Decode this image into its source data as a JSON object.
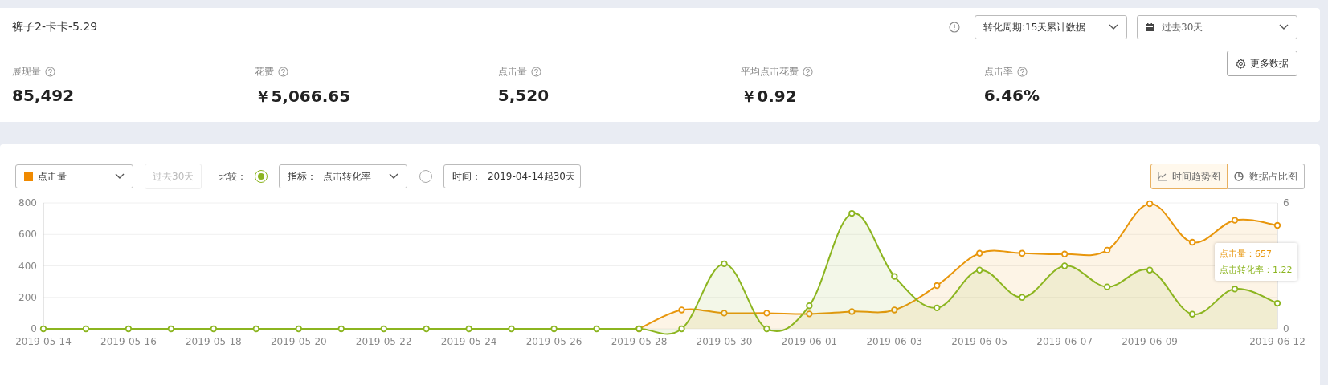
{
  "header": {
    "title": "裤子2-卡卡-5.29",
    "conversion_period": "转化周期:15天累计数据",
    "date_range": "过去30天",
    "more_button": "更多数据"
  },
  "metrics": [
    {
      "label": "展现量",
      "value": "85,492"
    },
    {
      "label": "花费",
      "value": "￥5,066.65"
    },
    {
      "label": "点击量",
      "value": "5,520"
    },
    {
      "label": "平均点击花费",
      "value": "￥0.92"
    },
    {
      "label": "点击率",
      "value": "6.46%"
    }
  ],
  "controls": {
    "metric": {
      "label": "点击量",
      "color": "#f08a00"
    },
    "period": "过去30天",
    "compare_label": "比较：",
    "compare_options": [
      {
        "kind": "metric",
        "label": "指标：",
        "value": "点击转化率",
        "selected": true
      },
      {
        "kind": "time",
        "label": "时间：",
        "value": "2019-04-14起30天",
        "selected": false
      }
    ]
  },
  "view_tabs": [
    {
      "kind": "line",
      "label": "时间趋势图",
      "selected": true
    },
    {
      "kind": "pie",
      "label": "数据占比图",
      "selected": false
    }
  ],
  "chart": {
    "chart_data": {
      "type": "line",
      "x": [
        "2019-05-14",
        "2019-05-15",
        "2019-05-16",
        "2019-05-17",
        "2019-05-18",
        "2019-05-19",
        "2019-05-20",
        "2019-05-21",
        "2019-05-22",
        "2019-05-23",
        "2019-05-24",
        "2019-05-25",
        "2019-05-26",
        "2019-05-27",
        "2019-05-28",
        "2019-05-29",
        "2019-05-30",
        "2019-05-31",
        "2019-06-01",
        "2019-06-02",
        "2019-06-03",
        "2019-06-04",
        "2019-06-05",
        "2019-06-06",
        "2019-06-07",
        "2019-06-08",
        "2019-06-09",
        "2019-06-10",
        "2019-06-11",
        "2019-06-12"
      ],
      "xticks": [
        "2019-05-14",
        "2019-05-16",
        "2019-05-18",
        "2019-05-20",
        "2019-05-22",
        "2019-05-24",
        "2019-05-26",
        "2019-05-28",
        "2019-05-30",
        "2019-06-01",
        "2019-06-03",
        "2019-06-05",
        "2019-06-07",
        "2019-06-09",
        "2019-06-12"
      ],
      "grid": true,
      "xlim": [
        "2019-05-14",
        "2019-06-12"
      ],
      "ylim": [
        0,
        800
      ],
      "yticks": [
        0,
        200,
        400,
        600,
        800
      ],
      "y2lim": [
        0,
        6
      ],
      "y2ticks": [
        0,
        6
      ],
      "series": [
        {
          "color": "#e8960c",
          "marker": "circle",
          "values": [
            null,
            null,
            null,
            null,
            null,
            null,
            null,
            null,
            null,
            null,
            null,
            null,
            null,
            null,
            0,
            120,
            100,
            100,
            95,
            110,
            120,
            275,
            480,
            480,
            475,
            500,
            795,
            550,
            690,
            657
          ]
        },
        {
          "color": "#8cb520",
          "marker": "circle",
          "axis": "y2",
          "values": [
            0,
            0,
            0,
            0,
            0,
            0,
            0,
            0,
            0,
            0,
            0,
            0,
            0,
            0,
            0,
            0,
            3.1,
            0,
            1.1,
            5.5,
            2.5,
            1,
            2.8,
            1.5,
            3,
            2,
            2.8,
            0.7,
            1.9,
            1.22
          ]
        }
      ]
    },
    "tooltip": [
      {
        "text": "点击量：657",
        "color": "#e8960c"
      },
      {
        "text": "点击转化率：1.22",
        "color": "#8cb520"
      }
    ]
  }
}
